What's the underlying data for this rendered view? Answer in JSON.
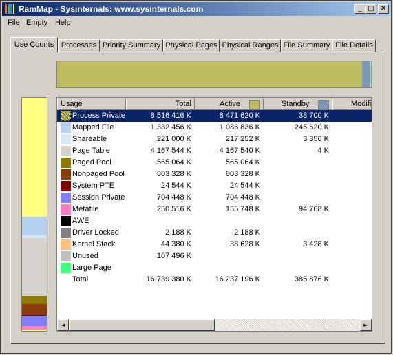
{
  "window": {
    "title": "RamMap - Sysinternals: www.sysinternals.com"
  },
  "title_buttons": {
    "minimize": "_",
    "maximize": "□",
    "close": "✕"
  },
  "menu": [
    {
      "label": "File"
    },
    {
      "label": "Empty"
    },
    {
      "label": "Help"
    }
  ],
  "tabs": [
    {
      "label": "Use Counts",
      "active": true
    },
    {
      "label": "Processes"
    },
    {
      "label": "Priority Summary"
    },
    {
      "label": "Physical Pages"
    },
    {
      "label": "Physical Ranges"
    },
    {
      "label": "File Summary"
    },
    {
      "label": "File Details"
    }
  ],
  "columns": {
    "usage": "Usage",
    "total": "Total",
    "active": "Active",
    "standby": "Standby",
    "modified": "Modifie"
  },
  "column_swatches": {
    "active": "#bdbd5f",
    "standby": "#7b98b8"
  },
  "rows": [
    {
      "usage": "Process Private",
      "total": "8 516 416 K",
      "active": "8 471 620 K",
      "standby": "38 700 K",
      "color": "#bdbd5f",
      "selected": true
    },
    {
      "usage": "Mapped File",
      "total": "1 332 456 K",
      "active": "1 086 836 K",
      "standby": "245 620 K",
      "color": "#b6d1f2"
    },
    {
      "usage": "Shareable",
      "total": "221 000 K",
      "active": "217 252 K",
      "standby": "3 356 K",
      "color": "#d6e8f8"
    },
    {
      "usage": "Page Table",
      "total": "4 167 544 K",
      "active": "4 167 540 K",
      "standby": "4 K",
      "color": "#d6d3ce"
    },
    {
      "usage": "Paged Pool",
      "total": "565 064 K",
      "active": "565 064 K",
      "standby": "",
      "color": "#8c7b00"
    },
    {
      "usage": "Nonpaged Pool",
      "total": "803 328 K",
      "active": "803 328 K",
      "standby": "",
      "color": "#8b3c0a"
    },
    {
      "usage": "System PTE",
      "total": "24 544 K",
      "active": "24 544 K",
      "standby": "",
      "color": "#840000"
    },
    {
      "usage": "Session Private",
      "total": "704 448 K",
      "active": "704 448 K",
      "standby": "",
      "color": "#8080ff"
    },
    {
      "usage": "Metafile",
      "total": "250 516 K",
      "active": "155 748 K",
      "standby": "94 768 K",
      "color": "#ff80c0"
    },
    {
      "usage": "AWE",
      "total": "",
      "active": "",
      "standby": "",
      "color": "#000000"
    },
    {
      "usage": "Driver Locked",
      "total": "2 188 K",
      "active": "2 188 K",
      "standby": "",
      "color": "#808080"
    },
    {
      "usage": "Kernel Stack",
      "total": "44 380 K",
      "active": "38 628 K",
      "standby": "3 428 K",
      "color": "#ffc080"
    },
    {
      "usage": "Unused",
      "total": "107 496 K",
      "active": "",
      "standby": "",
      "color": "#c0c0c0"
    },
    {
      "usage": "Large Page",
      "total": "",
      "active": "",
      "standby": "",
      "color": "#40ff80"
    },
    {
      "usage": "Total",
      "total": "16 739 380 K",
      "active": "16 237 196 K",
      "standby": "385 876 K",
      "color": ""
    }
  ],
  "scroll": {
    "left": "◄",
    "right": "►"
  },
  "horizontal_bar": [
    {
      "name": "active",
      "fraction": 0.97,
      "color": "#bdbd5f"
    },
    {
      "name": "standby",
      "fraction": 0.023,
      "color": "#7b98b8"
    },
    {
      "name": "modified",
      "fraction": 0.004,
      "color": "#d0d0d0"
    },
    {
      "name": "other",
      "fraction": 0.003,
      "color": "#40c080"
    }
  ],
  "vertical_bar": [
    {
      "name": "Process Private",
      "fraction": 0.509,
      "color": "#ffff80"
    },
    {
      "name": "Mapped File",
      "fraction": 0.08,
      "color": "#b6d1f2"
    },
    {
      "name": "Shareable",
      "fraction": 0.013,
      "color": "#d6e8f8"
    },
    {
      "name": "Page Table",
      "fraction": 0.249,
      "color": "#d6d3ce"
    },
    {
      "name": "Paged Pool",
      "fraction": 0.034,
      "color": "#8c7b00"
    },
    {
      "name": "Nonpaged Pool",
      "fraction": 0.048,
      "color": "#8b3c0a"
    },
    {
      "name": "System PTE",
      "fraction": 0.003,
      "color": "#840000"
    },
    {
      "name": "Session Private",
      "fraction": 0.042,
      "color": "#8080ff"
    },
    {
      "name": "Metafile",
      "fraction": 0.015,
      "color": "#ff80c0"
    },
    {
      "name": "Unused",
      "fraction": 0.007,
      "color": "#ffff80"
    }
  ]
}
